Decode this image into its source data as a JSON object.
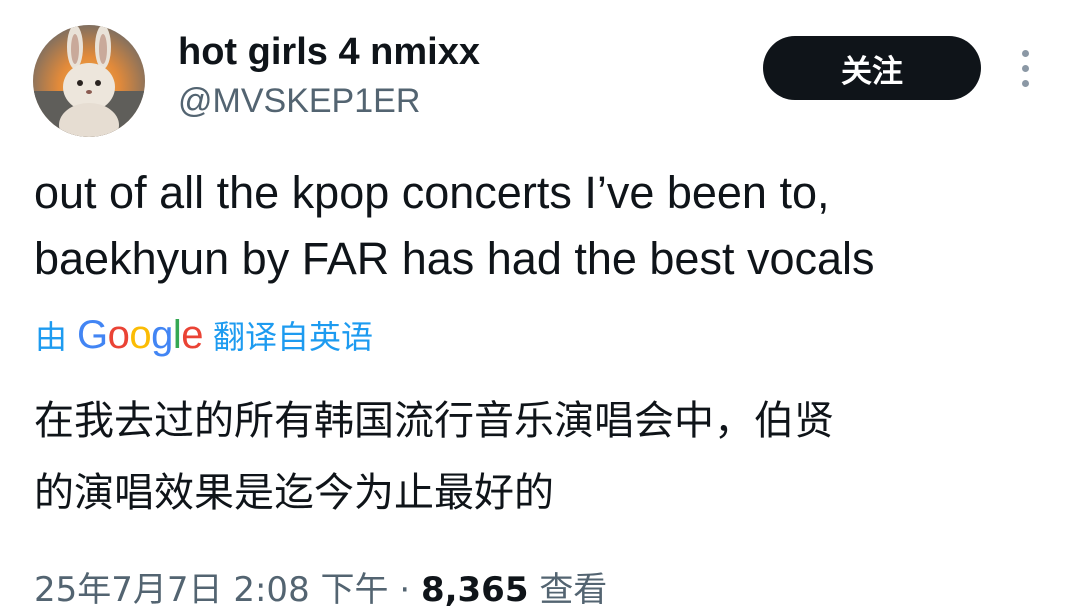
{
  "author": {
    "display_name": "hot girls 4 nmixx",
    "handle": "@MVSKEP1ER",
    "avatar_icon": "bunny-plush-avatar"
  },
  "actions": {
    "follow_label": "关注",
    "more_icon": "vertical-ellipsis-icon"
  },
  "tweet": {
    "lines": [
      "out of all the kpop concerts I’ve been to,",
      "baekhyun by FAR has had the best vocals"
    ]
  },
  "translation": {
    "prefix": "由",
    "provider": "Google",
    "suffix": "翻译自英语",
    "lines": [
      "在我去过的所有韩国流行音乐演唱会中，伯贤",
      "的演唱效果是迄今为止最好的"
    ]
  },
  "meta": {
    "date": "25年7月7日",
    "time": "2:08 下午",
    "separator": "·",
    "views_count": "8,365",
    "views_label": "查看"
  },
  "colors": {
    "link": "#1d9bf0",
    "text_primary": "#0f1419",
    "text_secondary": "#536471",
    "button_bg": "#0f1419",
    "google_blue": "#4285f4",
    "google_red": "#ea4335",
    "google_yellow": "#fbbc05",
    "google_green": "#34a853"
  }
}
